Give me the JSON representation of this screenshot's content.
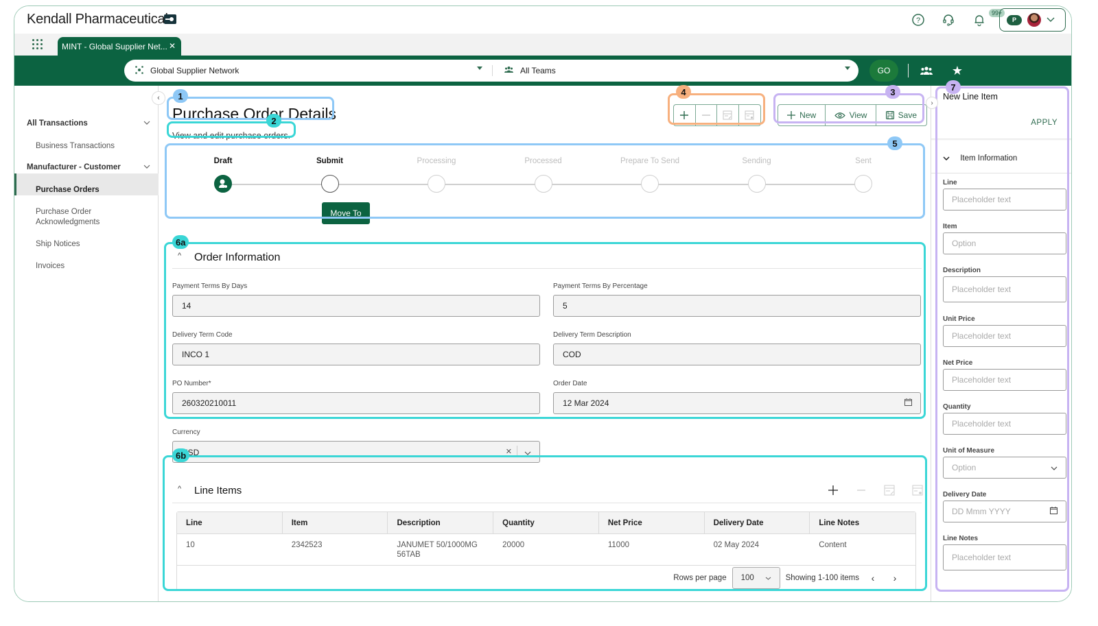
{
  "app": {
    "brand": "Kendall Pharmaceuticals",
    "notification_count": "99+"
  },
  "tabs": [
    {
      "label": "MINT - Global Supplier Net...",
      "active": true
    }
  ],
  "selector": {
    "network": "Global Supplier Network",
    "team": "All Teams",
    "go_label": "GO"
  },
  "sidebar": {
    "groups": [
      {
        "label": "All Transactions",
        "items": [
          "Business Transactions"
        ]
      },
      {
        "label": "Manufacturer - Customer",
        "items": [
          "Purchase Orders",
          "Purchase Order Acknowledgments",
          "Ship Notices",
          "Invoices"
        ]
      }
    ],
    "active_item": "Purchase Orders"
  },
  "page": {
    "title": "Purchase Order Details",
    "subtitle": "View and edit purchase orders."
  },
  "toolbar": {
    "new_label": "New",
    "view_label": "View",
    "save_label": "Save"
  },
  "stepper": {
    "steps": [
      "Draft",
      "Submit",
      "Processing",
      "Processed",
      "Prepare To Send",
      "Sending",
      "Sent"
    ],
    "current_index": 0,
    "move_label": "Move To"
  },
  "order_info": {
    "title": "Order Information",
    "fields": {
      "payment_terms_days": {
        "label": "Payment Terms By Days",
        "value": "14"
      },
      "payment_terms_pct": {
        "label": "Payment Terms By Percentage",
        "value": "5"
      },
      "delivery_term_code": {
        "label": "Delivery Term Code",
        "value": "INCO 1"
      },
      "delivery_term_desc": {
        "label": "Delivery Term Description",
        "value": "COD"
      },
      "po_number": {
        "label": "PO Number*",
        "value": "260320210011"
      },
      "order_date": {
        "label": "Order Date",
        "value": "12 Mar 2024"
      },
      "currency": {
        "label": "Currency",
        "value": "USD"
      }
    }
  },
  "line_items": {
    "title": "Line Items",
    "columns": [
      "Line",
      "Item",
      "Description",
      "Quantity",
      "Net Price",
      "Delivery Date",
      "Line Notes"
    ],
    "rows": [
      [
        "10",
        "2342523",
        "JANUMET 50/1000MG 56TAB",
        "20000",
        "11000",
        "02 May 2024",
        "Content"
      ]
    ],
    "rows_per_page_label": "Rows per page",
    "rows_per_page": "100",
    "showing": "Showing 1-100 items"
  },
  "new_line_item": {
    "title": "New Line Item",
    "apply_label": "APPLY",
    "section": "Item Information",
    "fields": [
      {
        "label": "Line",
        "placeholder": "Placeholder text"
      },
      {
        "label": "Item",
        "placeholder": "Option"
      },
      {
        "label": "Description",
        "placeholder": "Placeholder text"
      },
      {
        "label": "Unit Price",
        "placeholder": "Placeholder text"
      },
      {
        "label": "Net Price",
        "placeholder": "Placeholder text"
      },
      {
        "label": "Quantity",
        "placeholder": "Placeholder text"
      },
      {
        "label": "Unit of Measure",
        "placeholder": "Option"
      },
      {
        "label": "Delivery Date",
        "placeholder": "DD Mmm YYYY"
      },
      {
        "label": "Line Notes",
        "placeholder": "Placeholder text"
      }
    ]
  },
  "annotations": [
    {
      "id": "1",
      "color": "#8ec8f6"
    },
    {
      "id": "2",
      "color": "#3ad6d6"
    },
    {
      "id": "3",
      "color": "#c7b3f2"
    },
    {
      "id": "4",
      "color": "#f7b07e"
    },
    {
      "id": "5",
      "color": "#8ec8f6"
    },
    {
      "id": "6a",
      "color": "#3ad6d6"
    },
    {
      "id": "6b",
      "color": "#3ad6d6"
    },
    {
      "id": "7",
      "color": "#c7b3f2"
    }
  ]
}
